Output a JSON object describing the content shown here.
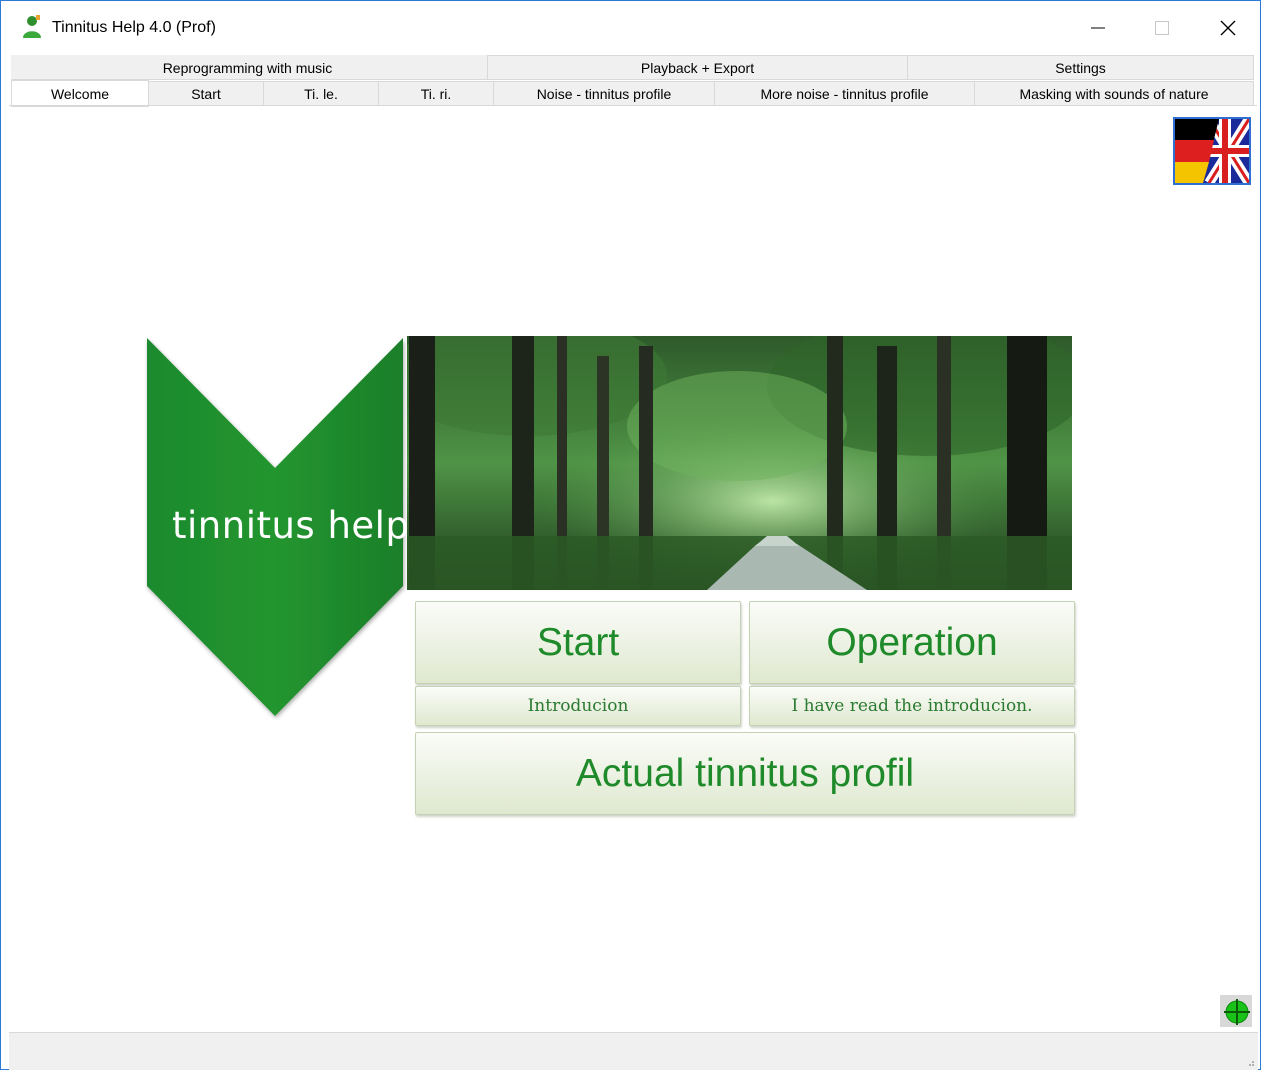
{
  "window": {
    "title": "Tinnitus Help 4.0 (Prof)",
    "controls": [
      "minimize-icon",
      "maximize-icon",
      "close-icon"
    ]
  },
  "tab_groups": [
    {
      "label": "Reprogramming with music"
    },
    {
      "label": "Playback + Export"
    },
    {
      "label": "Settings"
    }
  ],
  "tabs": [
    {
      "label": "Welcome",
      "active": true
    },
    {
      "label": "Start"
    },
    {
      "label": "Ti. le."
    },
    {
      "label": "Ti. ri."
    },
    {
      "label": "Noise - tinnitus profile"
    },
    {
      "label": "More noise - tinnitus profile"
    },
    {
      "label": "Masking with sounds of nature"
    }
  ],
  "language_flag": {
    "icon": "de-uk-flag-icon"
  },
  "logo": {
    "text": "tinnitus help",
    "color": "#1f8a2e"
  },
  "buttons": {
    "start": "Start",
    "operation": "Operation",
    "introduction": "Introducion",
    "read_intro": "I have read the introducion.",
    "profil": "Actual tinnitus profil"
  },
  "colors": {
    "accent_green": "#1e8a2a",
    "button_bg": "#eef3e6",
    "window_border": "#2b7ad6"
  },
  "status_icon": "network-status-icon"
}
